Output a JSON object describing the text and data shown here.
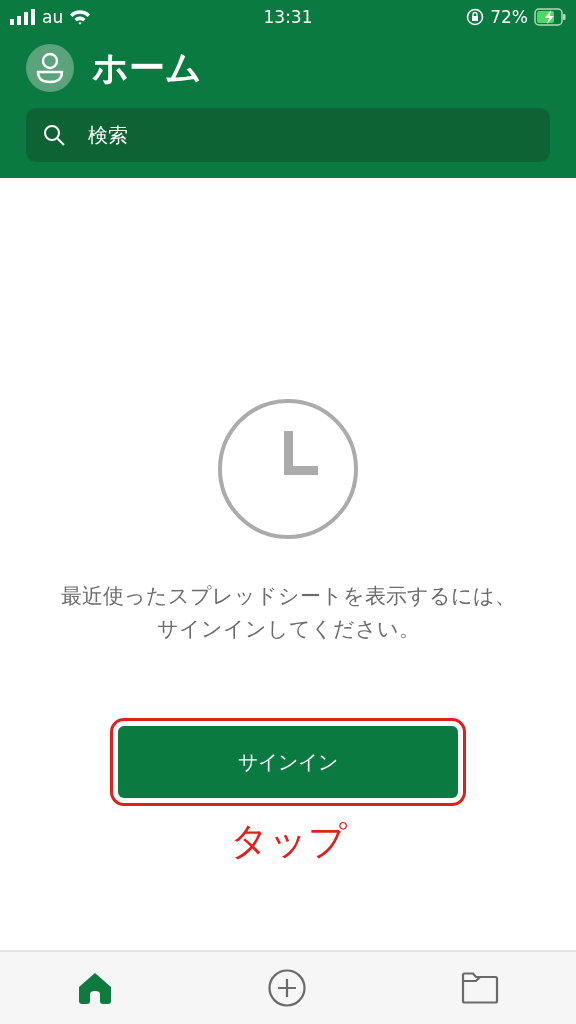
{
  "status_bar": {
    "carrier": "au",
    "time": "13:31",
    "battery": "72%"
  },
  "header": {
    "title": "ホーム",
    "search": {
      "placeholder": "検索"
    }
  },
  "empty_state": {
    "message": "最近使ったスプレッドシートを表示するには、サインインしてください。",
    "button": "サインイン"
  },
  "annotation": {
    "text": "タップ"
  },
  "tab_bar": [
    {
      "kind": "home",
      "selected": true
    },
    {
      "kind": "add",
      "selected": false
    },
    {
      "kind": "folder",
      "selected": false
    }
  ]
}
